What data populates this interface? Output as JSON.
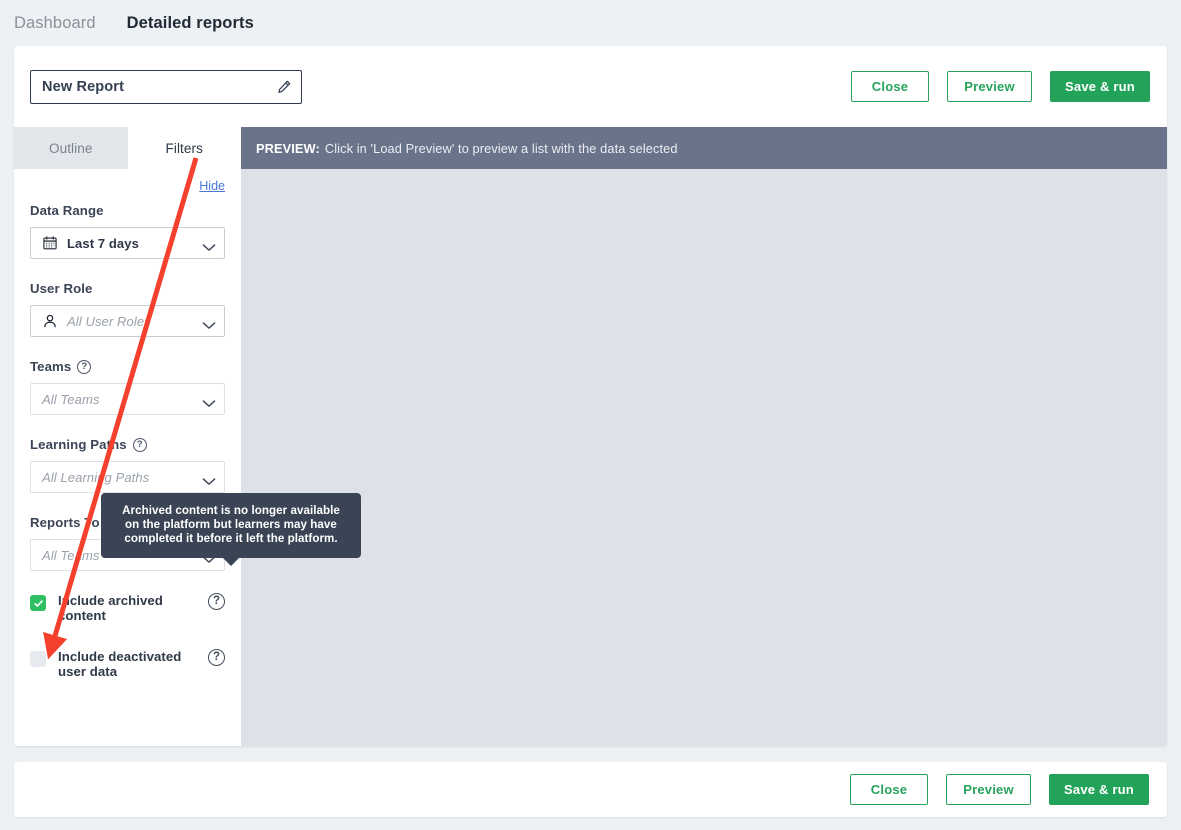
{
  "topnav": {
    "items": [
      {
        "label": "Dashboard",
        "active": false
      },
      {
        "label": "Detailed reports",
        "active": true
      }
    ]
  },
  "report": {
    "title_value": "New Report",
    "edit_icon": "pencil-icon"
  },
  "actions": {
    "close_label": "Close",
    "preview_label": "Preview",
    "save_label": "Save & run"
  },
  "tabs": [
    {
      "label": "Outline",
      "active": false
    },
    {
      "label": "Filters",
      "active": true
    }
  ],
  "filters": {
    "hide_label": "Hide",
    "data_range": {
      "label": "Data Range",
      "value": "Last 7 days",
      "icon": "calendar-icon",
      "disabled": false
    },
    "user_role": {
      "label": "User Role",
      "placeholder": "All User Roles",
      "icon": "person-icon",
      "disabled": false
    },
    "teams": {
      "label": "Teams",
      "placeholder": "All Teams",
      "help_icon": "question-icon",
      "disabled": true
    },
    "learning_paths": {
      "label": "Learning Paths",
      "placeholder": "All Learning Paths",
      "help_icon": "question-icon",
      "disabled": true
    },
    "reports_to": {
      "label": "Reports To",
      "placeholder": "All Teams",
      "help_icon": "question-icon",
      "disabled": true
    },
    "include_archived": {
      "label": "Include archived content",
      "checked": true,
      "help_icon": "question-icon"
    },
    "include_deactivated": {
      "label": "Include deactivated user data",
      "checked": false,
      "help_icon": "question-icon"
    }
  },
  "tooltip": {
    "text": "Archived content is no longer available on the platform but learners may have completed it before it left the platform."
  },
  "preview": {
    "label": "PREVIEW:",
    "text": "Click in 'Load Preview' to preview a list with the data selected"
  },
  "colors": {
    "brand_green": "#23a25a",
    "checkbox_green": "#2fbf63",
    "preview_bar": "#69748a",
    "tooltip_bg": "#3a4454",
    "link_blue": "#4a79d4",
    "annotation_red": "#f4402d",
    "page_bg": "#eef1f4"
  }
}
